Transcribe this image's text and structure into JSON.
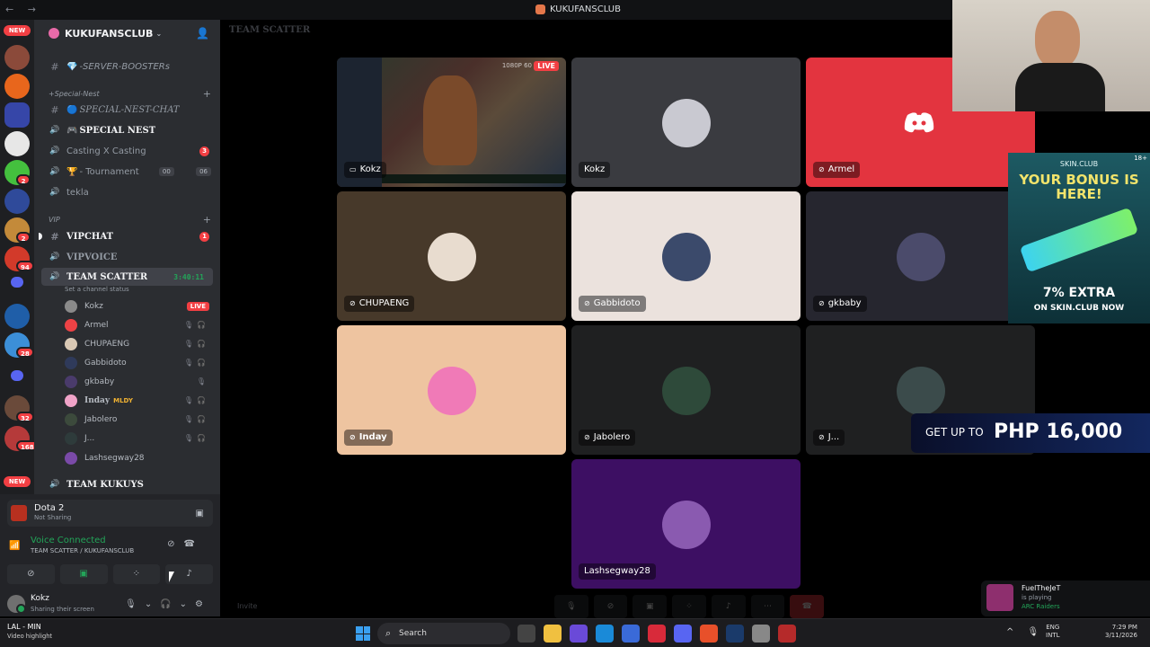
{
  "titlebar": {
    "title": "KUKUFANSCLUB",
    "nav": "← →"
  },
  "rail": {
    "new_label_top": "NEW",
    "new_label_bottom": "NEW",
    "badges": [
      "2",
      "2",
      "94",
      "28",
      "32",
      "168"
    ]
  },
  "sidebar": {
    "guild_name": "KUKUFANSCLUB",
    "channels": [
      {
        "name": "-SERVER-BOOSTERs",
        "kind": "text",
        "emoji": "💎"
      },
      {
        "name": "+Special-Nest",
        "kind": "category"
      },
      {
        "name": "SPECIAL-NEST-CHAT",
        "kind": "text",
        "emoji": "🔵"
      },
      {
        "name": "SPECIAL NEST",
        "kind": "voice",
        "emoji": "🎮"
      },
      {
        "name": "Casting X Casting",
        "kind": "voice",
        "badge": "3"
      },
      {
        "name": "- Tournament",
        "kind": "voice",
        "emoji": "🏆",
        "pills": [
          "00",
          "06"
        ]
      },
      {
        "name": "tekla",
        "kind": "voice"
      },
      {
        "name": "VIP",
        "kind": "category"
      },
      {
        "name": "VIPCHAT",
        "kind": "text",
        "badge": "1"
      },
      {
        "name": "VIPVOICE",
        "kind": "voice"
      },
      {
        "name": "TEAM SCATTER",
        "kind": "voice",
        "timer": "3:40:11"
      },
      {
        "name": "TEAM KUKUYS",
        "kind": "voice"
      }
    ],
    "channel_status": "Set a channel status",
    "members": [
      {
        "name": "Kokz",
        "tag": "LIVE",
        "color": "#8a8a8a"
      },
      {
        "name": "Armel",
        "color": "#ed4245"
      },
      {
        "name": "CHUPAENG",
        "color": "#d9c8b4"
      },
      {
        "name": "Gabbidoto",
        "color": "#2f3a5a"
      },
      {
        "name": "gkbaby",
        "color": "#4a3b6b"
      },
      {
        "name": "Inday",
        "tag": "MLDY",
        "color": "#f0a3c8"
      },
      {
        "name": "Jabolero",
        "color": "#3c4a3c"
      },
      {
        "name": "J...",
        "color": "#2e3b3b"
      },
      {
        "name": "Lashsegway28",
        "color": "#7a4aa8"
      }
    ]
  },
  "panel": {
    "game_title": "Dota 2",
    "game_status": "Not Sharing",
    "voice_status": "Voice Connected",
    "voice_location": "TEAM SCATTER / KUKUFANSCLUB",
    "user_name": "Kokz",
    "user_status": "Sharing their screen"
  },
  "stage": {
    "header": "TEAM SCATTER",
    "tiles": [
      {
        "name": "Kokz",
        "bg": "#2b2d31",
        "stream": true,
        "live": "LIVE",
        "res": "1080P 60"
      },
      {
        "name": "Kokz",
        "bg": "#3a3b40",
        "avatar": "#c9c9d1"
      },
      {
        "name": "Armel",
        "bg": "#e3343f",
        "discord": true
      },
      {
        "name": "CHUPAENG",
        "bg": "#47392a",
        "avatar": "#e8dccf"
      },
      {
        "name": "Gabbidoto",
        "bg": "#ebe2dd",
        "avatar": "#3b4a6b"
      },
      {
        "name": "gkbaby",
        "bg": "#26262f",
        "avatar": "#4b4b6b"
      },
      {
        "name": "Inday",
        "bg": "#eec4a0",
        "avatar": "#f07ab7"
      },
      {
        "name": "Jabolero",
        "bg": "#1f2021",
        "avatar": "#2e4a3a"
      },
      {
        "name": "J...",
        "bg": "#1f2021",
        "avatar": "#3b4b4b"
      },
      {
        "name": "Lashsegway28",
        "bg": "#3d0f63",
        "avatar": "#8a5ab0"
      }
    ],
    "invite": "Invite"
  },
  "ad": {
    "brand": "SKIN.CLUB",
    "age": "18+",
    "headline": "YOUR BONUS IS HERE!",
    "extra": "7% EXTRA",
    "cta": "ON SKIN.CLUB NOW"
  },
  "promo": {
    "prefix": "GET UP TO",
    "amount": "PHP 16,000"
  },
  "toast": {
    "name": "FuelTheJeT",
    "action": "is playing",
    "game": "ARC Raiders"
  },
  "taskbar": {
    "weather_title": "LAL - MIN",
    "weather_sub": "Video highlight",
    "search": "Search",
    "lang_top": "ENG",
    "lang_bottom": "INTL",
    "time": "7:29 PM",
    "date": "3/11/2026"
  }
}
